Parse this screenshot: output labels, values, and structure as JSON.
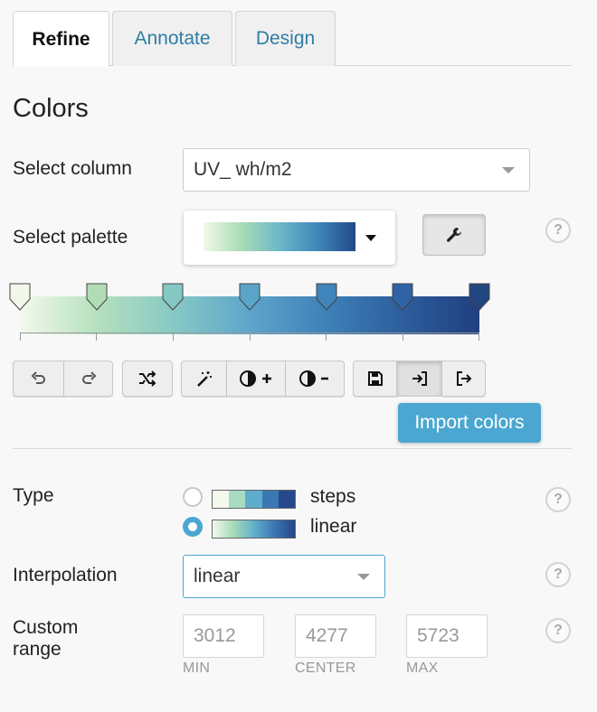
{
  "tabs": [
    {
      "label": "Refine",
      "active": true
    },
    {
      "label": "Annotate",
      "active": false
    },
    {
      "label": "Design",
      "active": false
    }
  ],
  "colors_section": {
    "title": "Colors",
    "select_column": {
      "label": "Select column",
      "value": "UV_ wh/m2"
    },
    "select_palette": {
      "label": "Select palette",
      "help": "?"
    },
    "palette_stops": [
      "#f1f8e9",
      "#b2dcb5",
      "#84c7c3",
      "#5aa4c8",
      "#3f84ba",
      "#2e63a6",
      "#22467f"
    ],
    "toolbar": {
      "undo": "undo-icon",
      "redo": "redo-icon",
      "shuffle": "shuffle-icon",
      "magic": "magic-wand-icon",
      "contrast_plus": "contrast-increase-icon",
      "contrast_minus": "contrast-decrease-icon",
      "save": "save-icon",
      "import": "import-icon",
      "export": "export-icon"
    },
    "tooltip": "Import colors"
  },
  "type_section": {
    "label": "Type",
    "help": "?",
    "options": [
      {
        "label": "steps",
        "checked": false
      },
      {
        "label": "linear",
        "checked": true
      }
    ],
    "step_swatches": [
      "#f3f9ec",
      "#a8dcc2",
      "#5fadcc",
      "#3a77b3",
      "#25488c"
    ]
  },
  "interpolation": {
    "label": "Interpolation",
    "value": "linear",
    "help": "?"
  },
  "custom_range": {
    "label_line1": "Custom",
    "label_line2": "range",
    "help": "?",
    "min": {
      "placeholder": "3012",
      "caption": "MIN"
    },
    "center": {
      "placeholder": "4277",
      "caption": "CENTER"
    },
    "max": {
      "placeholder": "5723",
      "caption": "MAX"
    }
  },
  "accent_color": "#4ba7d1"
}
